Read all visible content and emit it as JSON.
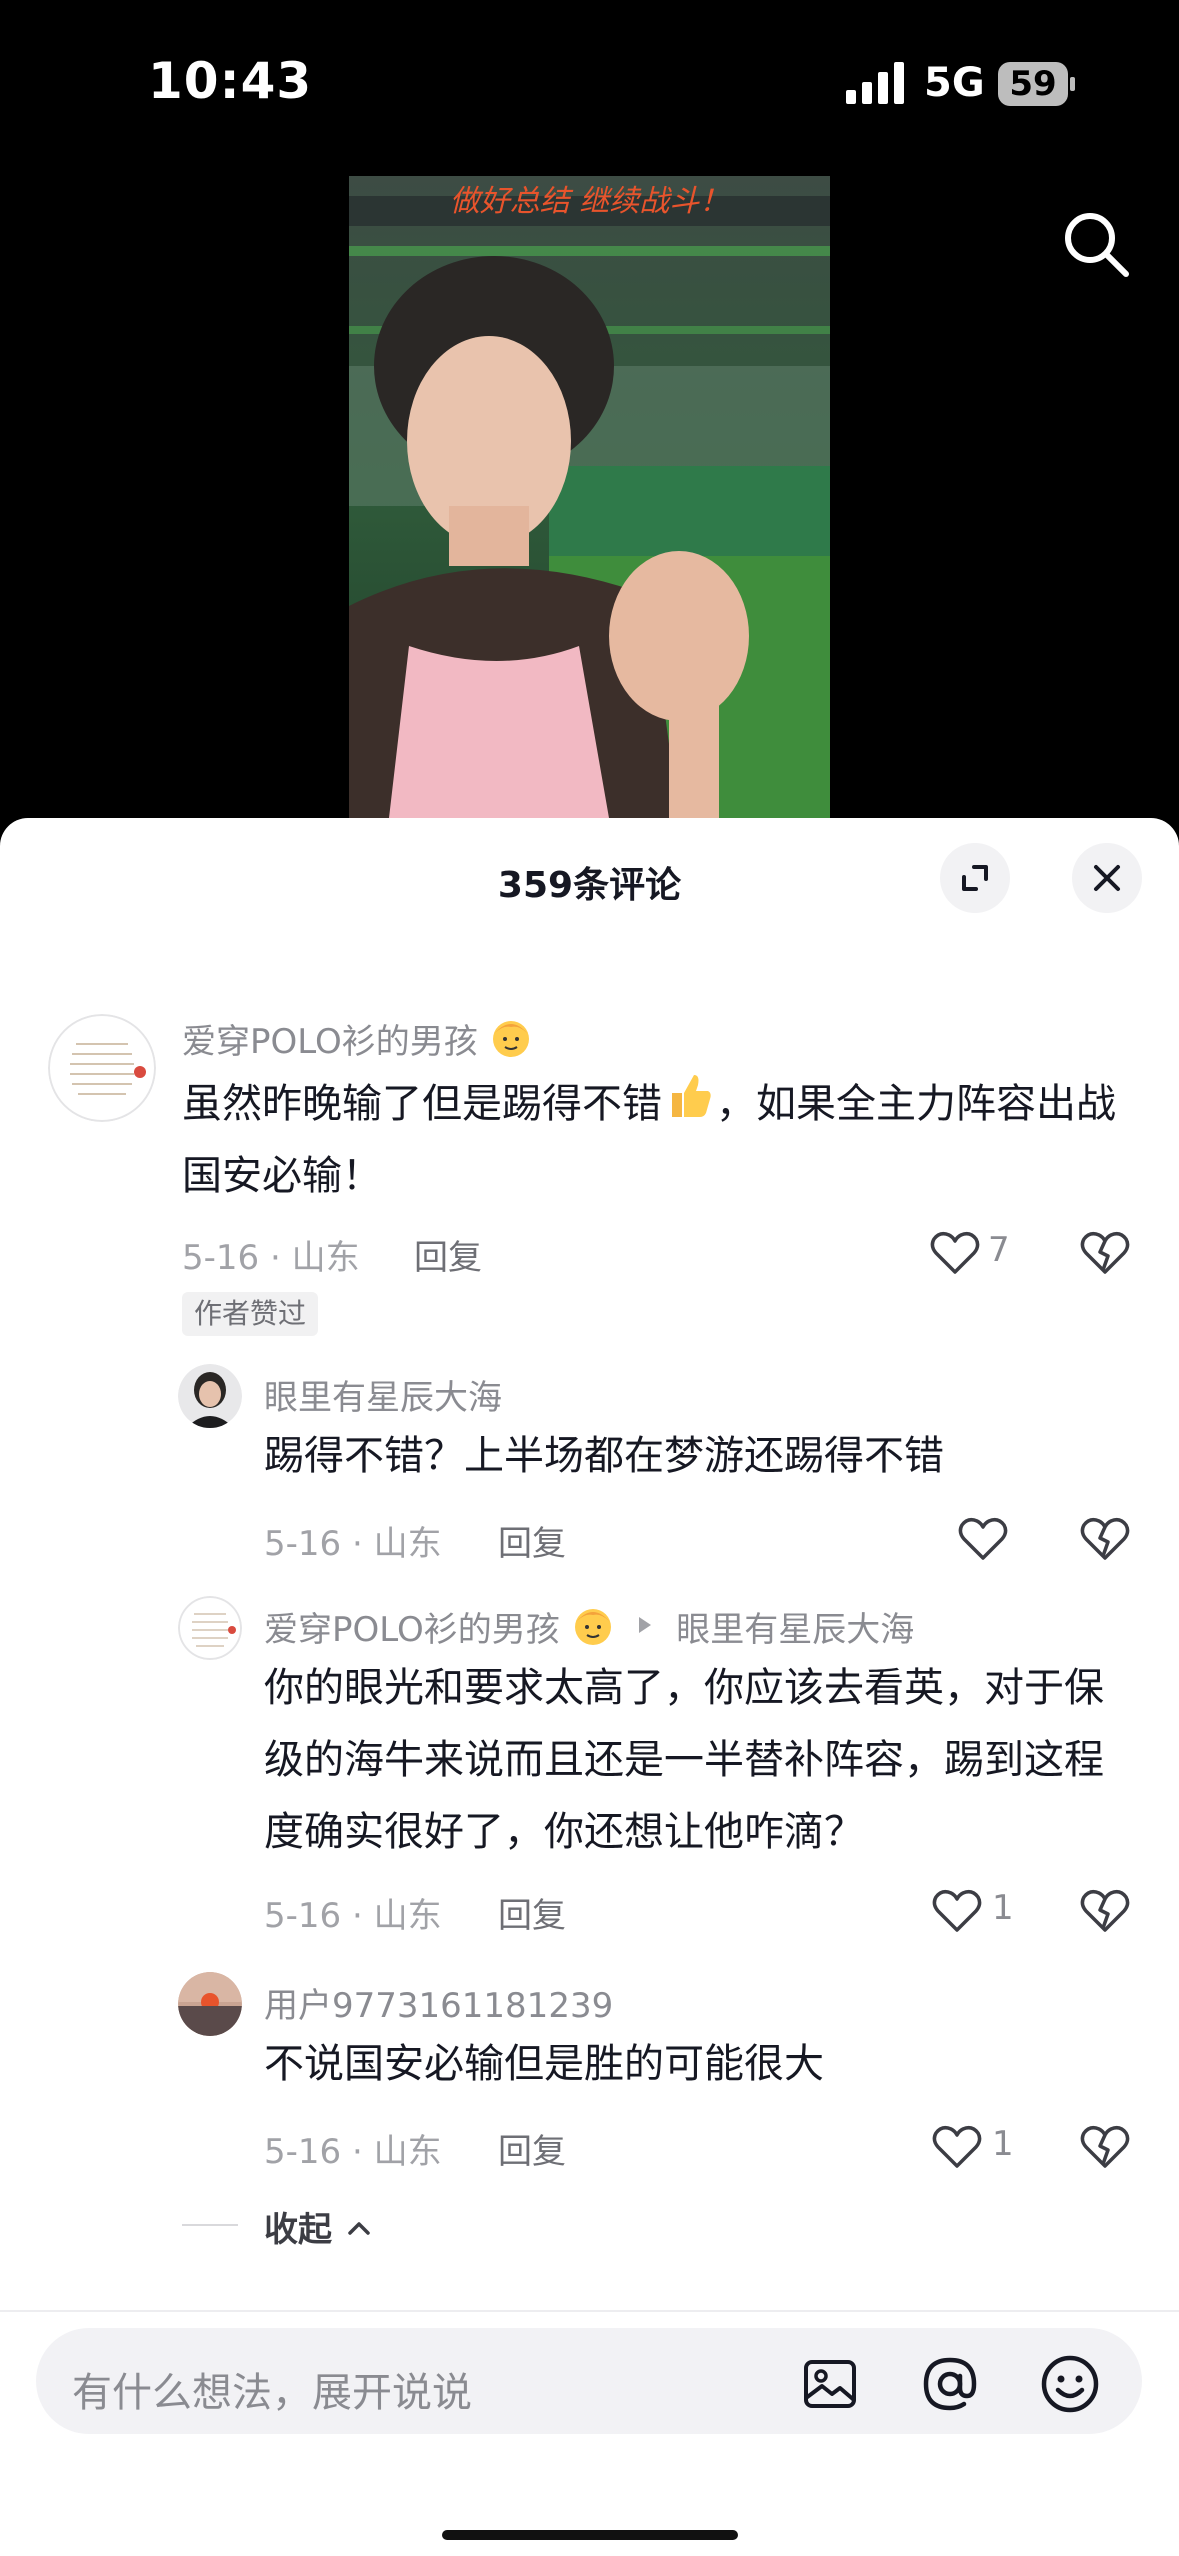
{
  "status_bar": {
    "time": "10:43",
    "network": "5G",
    "battery": "59"
  },
  "video": {
    "caption": "做好总结 继续战斗！"
  },
  "comments_panel": {
    "title": "359条评论",
    "comments": [
      {
        "user": "爱穿POLO衫的男孩",
        "text_before_emoji": "虽然昨晚输了但是踢得不错",
        "text_after_emoji": "，如果全主力阵容出战国安必输！",
        "meta": "5-16 · 山东",
        "reply_label": "回复",
        "likes": "7",
        "badge": "作者赞过"
      },
      {
        "user": "眼里有星辰大海",
        "text": "踢得不错？上半场都在梦游还踢得不错",
        "meta": "5-16 · 山东",
        "reply_label": "回复",
        "likes": ""
      },
      {
        "user": "爱穿POLO衫的男孩",
        "reply_to": "眼里有星辰大海",
        "text": "你的眼光和要求太高了，你应该去看英，对于保级的海牛来说而且还是一半替补阵容，踢到这程度确实很好了，你还想让他咋滴？",
        "meta": "5-16 · 山东",
        "reply_label": "回复",
        "likes": "1"
      },
      {
        "user": "用户9773161181239",
        "text": "不说国安必输但是胜的可能很大",
        "meta": "5-16 · 山东",
        "reply_label": "回复",
        "likes": "1"
      }
    ],
    "collapse_label": "收起"
  },
  "input": {
    "placeholder": "有什么想法，展开说说"
  },
  "icons": {
    "search": "search-icon",
    "expand": "expand-icon",
    "close": "close-icon",
    "heart": "heart-icon",
    "dislike": "broken-heart-icon",
    "image": "image-icon",
    "mention": "at-icon",
    "emoji": "emoji-icon"
  }
}
